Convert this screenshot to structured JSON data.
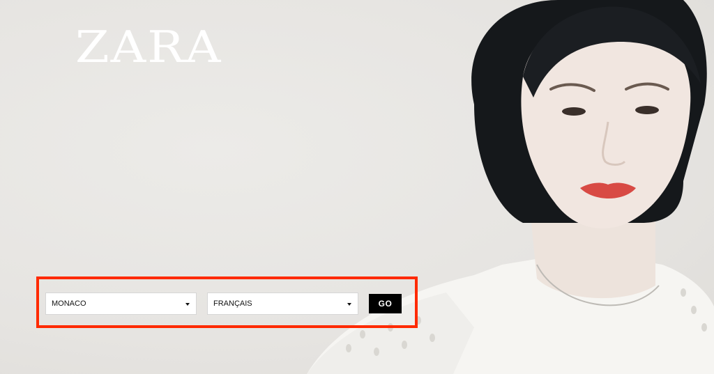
{
  "brand": {
    "logo_text": "ZARA"
  },
  "hero": {
    "image_icon": "model-portrait-image"
  },
  "selector": {
    "country": {
      "selected": "MONACO",
      "icon": "caret-down-icon"
    },
    "language": {
      "selected": "FRANÇAIS",
      "icon": "caret-down-icon"
    },
    "go_label": "GO",
    "highlight_color": "#ff2a00"
  }
}
